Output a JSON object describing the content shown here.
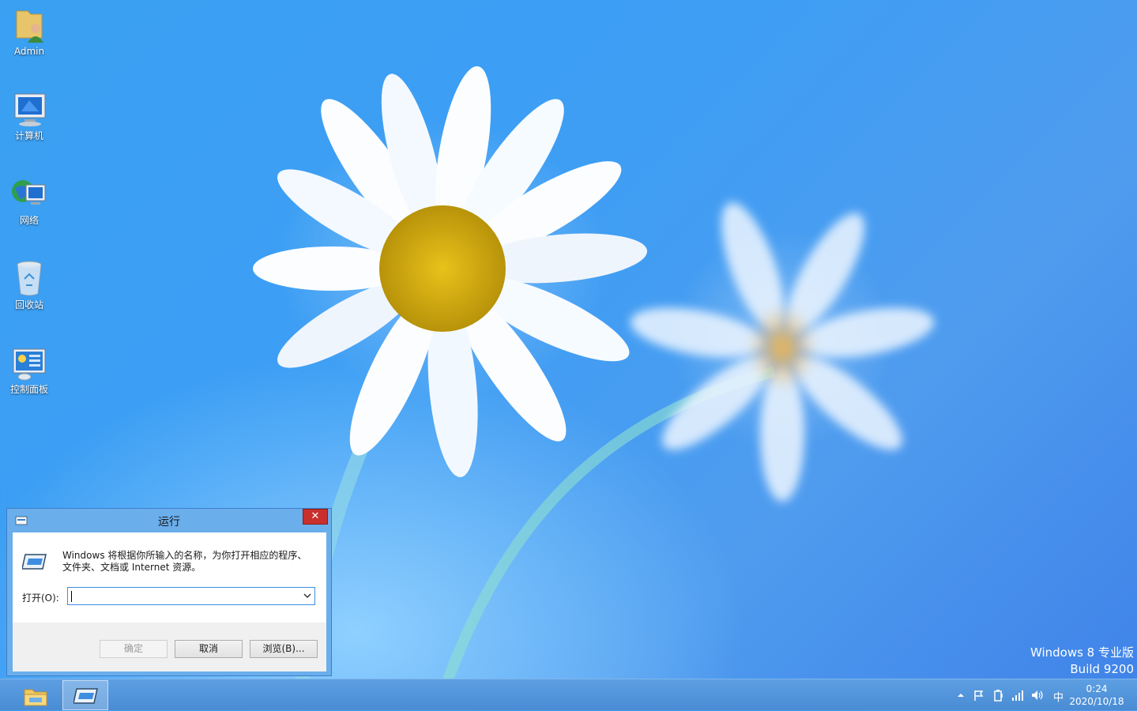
{
  "desktop": {
    "icons": [
      {
        "label": "Admin",
        "icon": "user-folder-icon"
      },
      {
        "label": "计算机",
        "icon": "computer-icon"
      },
      {
        "label": "网络",
        "icon": "network-icon"
      },
      {
        "label": "回收站",
        "icon": "recycle-bin-icon"
      },
      {
        "label": "控制面板",
        "icon": "control-panel-icon"
      }
    ],
    "watermark": {
      "line1": "Windows 8 专业版",
      "line2": "Build 9200"
    }
  },
  "run_dialog": {
    "title": "运行",
    "close_label": "✕",
    "description": "Windows 将根据你所输入的名称，为你打开相应的程序、文件夹、文档或 Internet 资源。",
    "open_label": "打开(O):",
    "open_value": "",
    "ok_label": "确定",
    "cancel_label": "取消",
    "browse_label": "浏览(B)..."
  },
  "taskbar": {
    "pinned": [
      {
        "icon": "file-explorer-icon",
        "active": false
      },
      {
        "icon": "run-dialog-icon",
        "active": true
      }
    ],
    "tray": {
      "icons": [
        "show-hidden-icons-icon",
        "action-center-flag-icon",
        "power-icon",
        "network-bars-icon",
        "volume-icon"
      ],
      "ime": "中",
      "time": "0:24",
      "date": "2020/10/18"
    }
  },
  "colors": {
    "desktop_blue": "#3d9ef4",
    "close_red": "#c9302c",
    "taskbar": "#4a8cd4"
  }
}
